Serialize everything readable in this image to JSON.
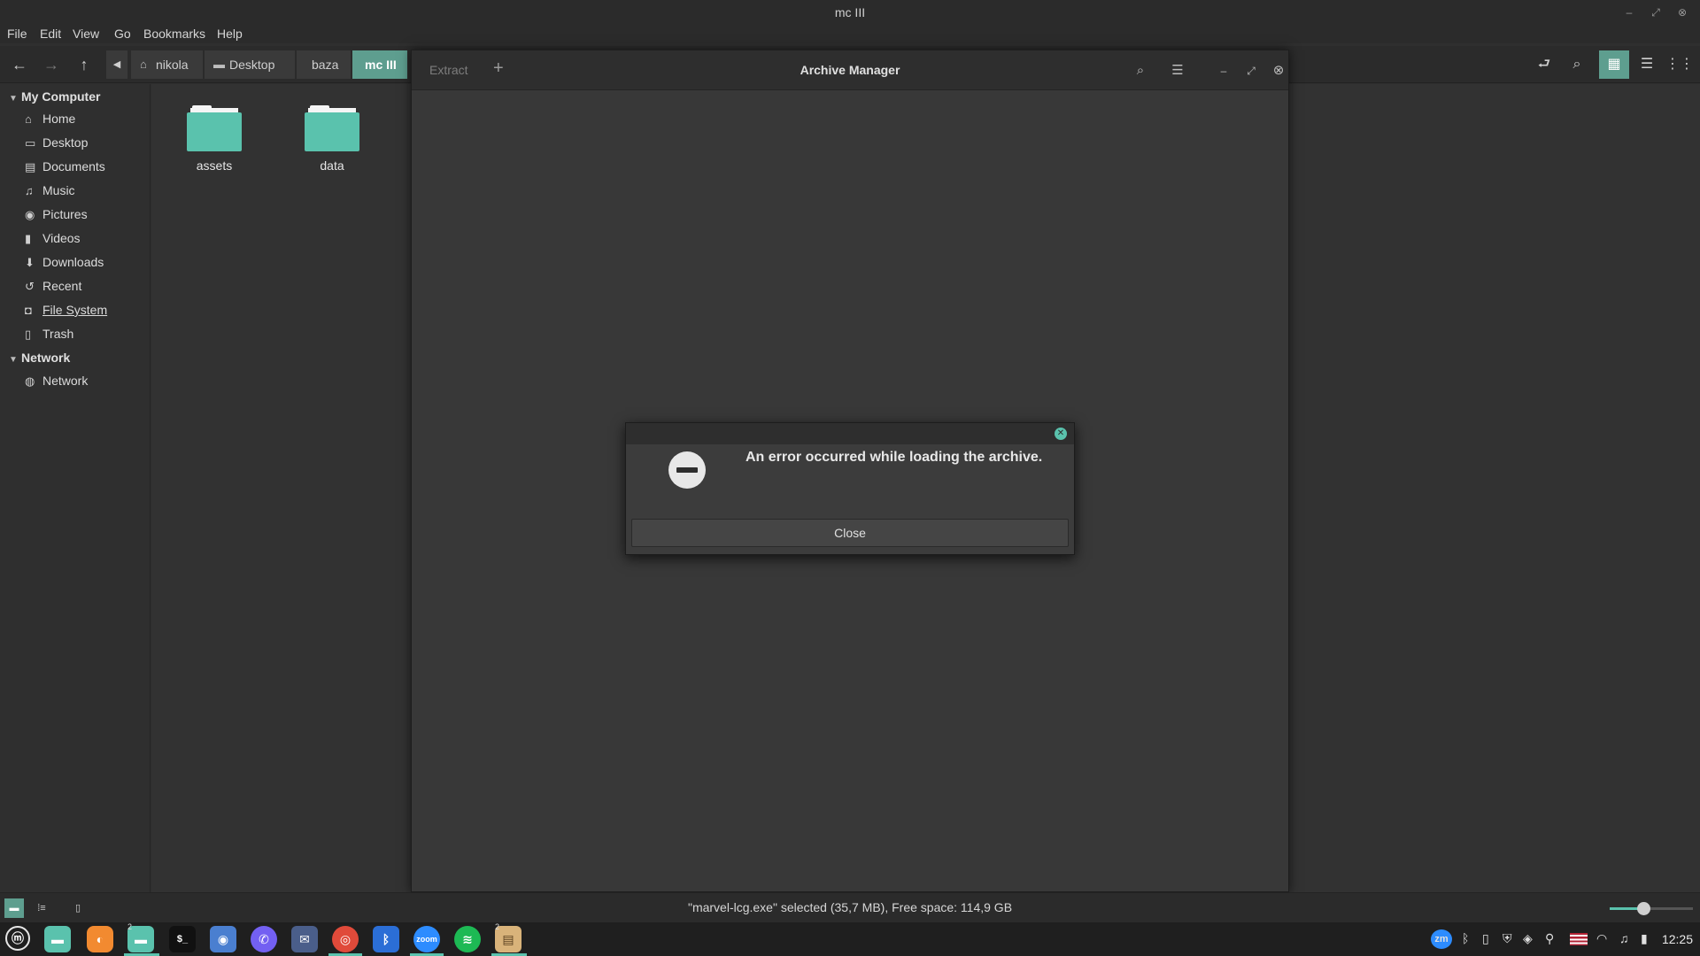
{
  "window": {
    "title": "mc III"
  },
  "menu": [
    "File",
    "Edit",
    "View",
    "Go",
    "Bookmarks",
    "Help"
  ],
  "breadcrumbs": [
    {
      "label": "nikola",
      "icon": "home-icon"
    },
    {
      "label": "Desktop",
      "icon": "folder-icon"
    },
    {
      "label": "baza",
      "icon": ""
    },
    {
      "label": "mc III",
      "icon": "",
      "active": true
    }
  ],
  "sidebar": {
    "sections": [
      {
        "title": "My Computer",
        "items": [
          {
            "label": "Home",
            "icon": "home-icon"
          },
          {
            "label": "Desktop",
            "icon": "desktop-icon"
          },
          {
            "label": "Documents",
            "icon": "document-icon"
          },
          {
            "label": "Music",
            "icon": "music-icon"
          },
          {
            "label": "Pictures",
            "icon": "camera-icon"
          },
          {
            "label": "Videos",
            "icon": "film-icon"
          },
          {
            "label": "Downloads",
            "icon": "download-icon"
          },
          {
            "label": "Recent",
            "icon": "clock-icon"
          },
          {
            "label": "File System",
            "icon": "drive-icon"
          },
          {
            "label": "Trash",
            "icon": "trash-icon"
          }
        ]
      },
      {
        "title": "Network",
        "items": [
          {
            "label": "Network",
            "icon": "globe-icon"
          }
        ]
      }
    ]
  },
  "files": [
    {
      "name": "assets",
      "type": "folder"
    },
    {
      "name": "data",
      "type": "folder"
    }
  ],
  "archive_manager": {
    "title": "Archive Manager",
    "extract_label": "Extract",
    "add_label": "+"
  },
  "dialog": {
    "message": "An error occurred while loading the archive.",
    "close_label": "Close"
  },
  "statusbar": {
    "text": "\"marvel-lcg.exe\" selected (35,7 MB), Free space: 114,9 GB",
    "zoom_fraction": 0.4
  },
  "taskbar": {
    "apps": [
      {
        "name": "Mint menu",
        "icon": "mint-icon",
        "color": "#2b2b2b"
      },
      {
        "name": "Files",
        "icon": "folder-icon",
        "color": "#5ac2ad"
      },
      {
        "name": "Firefox",
        "icon": "firefox-icon",
        "color": "#f28a30"
      },
      {
        "name": "Files",
        "icon": "folder-icon",
        "color": "#5ac2ad",
        "badge": "2",
        "running": true
      },
      {
        "name": "Terminal",
        "icon": "terminal-icon",
        "color": "#1a1a1a"
      },
      {
        "name": "Screenshot",
        "icon": "camera-icon",
        "color": "#4a7fd0"
      },
      {
        "name": "Viber",
        "icon": "viber-icon",
        "color": "#7360f2"
      },
      {
        "name": "Mail",
        "icon": "mail-icon",
        "color": "#4a5e8a"
      },
      {
        "name": "Chrome",
        "icon": "chrome-icon",
        "color": "#e04a3a"
      },
      {
        "name": "Bluetooth",
        "icon": "bluetooth-icon",
        "color": "#2b6ed6"
      },
      {
        "name": "Zoom",
        "icon": "zoom-icon",
        "color": "#2d8cff",
        "label": "zoom"
      },
      {
        "name": "Spotify",
        "icon": "spotify-icon",
        "color": "#1db954"
      },
      {
        "name": "Archive Manager",
        "icon": "archive-icon",
        "color": "#d9b37a",
        "badge": "2",
        "running": true
      }
    ],
    "tray_zoom_label": "zm",
    "clock": "12:25"
  }
}
